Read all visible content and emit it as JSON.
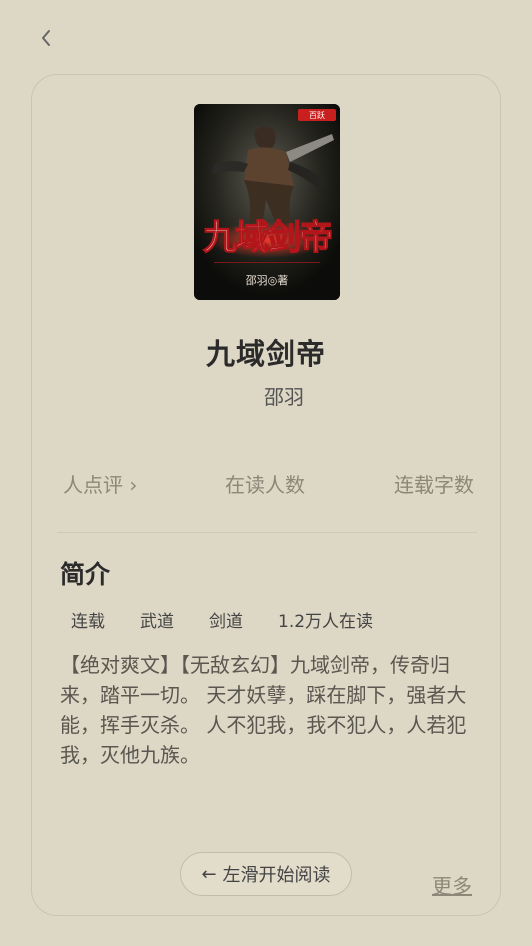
{
  "nav": {
    "back_icon": "chevron-left-icon"
  },
  "book": {
    "cover_title": "九域剑帝",
    "cover_author": "邵羽◎著",
    "cover_badge": "百跃",
    "title": "九域剑帝",
    "author": "邵羽"
  },
  "stats": {
    "reviews_label": "人点评 ›",
    "readers_label": "在读人数",
    "words_label": "连载字数"
  },
  "intro": {
    "title": "简介",
    "tags": [
      "连载",
      "武道",
      "剑道",
      "1.2万人在读"
    ],
    "description": "【绝对爽文】【无敌玄幻】九域剑帝，传奇归来，踏平一切。 天才妖孽，踩在脚下，强者大能，挥手灭杀。 人不犯我，我不犯人，人若犯我，灭他九族。"
  },
  "actions": {
    "start_arrow": "←",
    "start_label": "左滑开始阅读",
    "more_label": "更多"
  },
  "colors": {
    "background": "#ddd7c5",
    "accent_red": "#c9201f"
  }
}
